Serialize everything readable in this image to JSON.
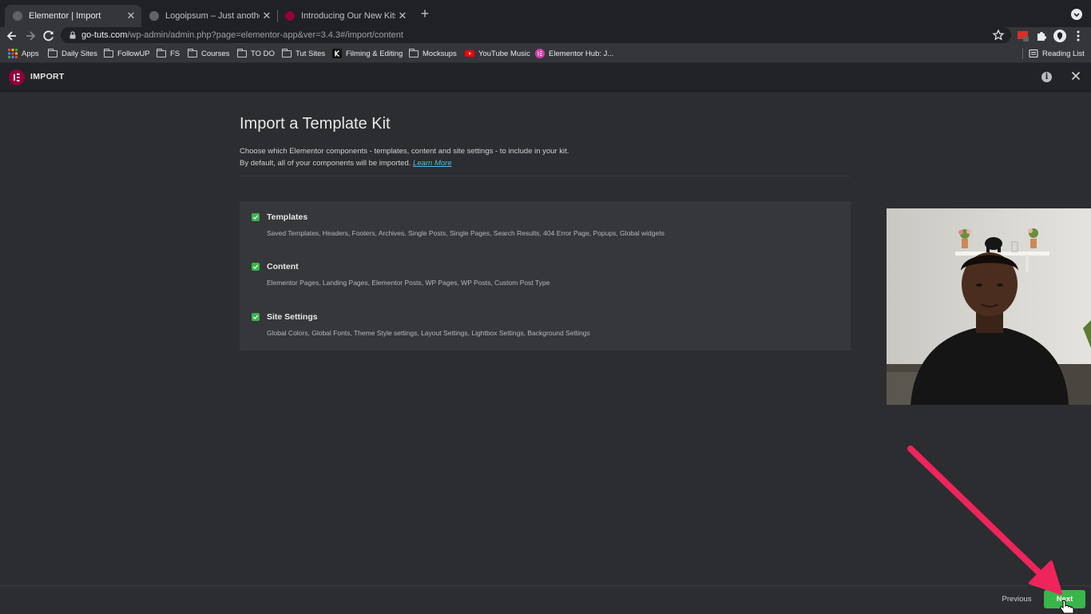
{
  "browser": {
    "tabs": [
      {
        "title": "Elementor | Import",
        "active": true
      },
      {
        "title": "Logoipsum – Just another Wor",
        "active": false
      },
      {
        "title": "Introducing Our New Kits Libra",
        "active": false
      }
    ],
    "url_host": "go-tuts.com",
    "url_path": "/wp-admin/admin.php?page=elementor-app&ver=3.4.3#/import/content",
    "bookmarks": [
      "Apps",
      "Daily Sites",
      "FollowUP",
      "FS",
      "Courses",
      "TO DO",
      "Tut Sites",
      "Filming & Editing",
      "Mocksups",
      "YouTube Music",
      "Elementor Hub: J..."
    ],
    "reading_list": "Reading List"
  },
  "app": {
    "title": "IMPORT"
  },
  "main": {
    "heading": "Import a Template Kit",
    "description_line1": "Choose which Elementor components - templates, content and site settings - to include in your kit.",
    "description_line2": "By default, all of your components will be imported.",
    "learn_more": "Learn More",
    "items": [
      {
        "title": "Templates",
        "description": "Saved Templates, Headers, Footers, Archives, Single Posts, Single Pages, Search Results, 404 Error Page, Popups, Global widgets",
        "checked": true
      },
      {
        "title": "Content",
        "description": "Elementor Pages, Landing Pages, Elementor Posts, WP Pages, WP Posts, Custom Post Type",
        "checked": true
      },
      {
        "title": "Site Settings",
        "description": "Global Colors, Global Fonts, Theme Style settings, Layout Settings, Lightbox Settings, Background Settings",
        "checked": true
      }
    ]
  },
  "footer": {
    "previous": "Previous",
    "next": "Next"
  },
  "colors": {
    "accent_green": "#39b54a",
    "elementor_brand": "#92003b",
    "link": "#58b6e8",
    "annotation_arrow": "#f0245c"
  }
}
